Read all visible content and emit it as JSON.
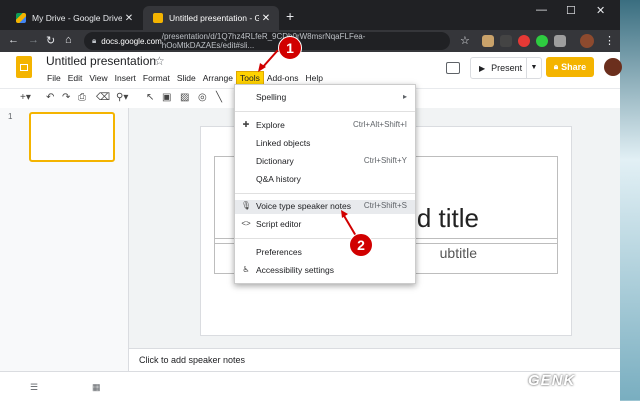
{
  "browser": {
    "tabs": [
      {
        "title": "My Drive - Google Drive",
        "active": false,
        "icon": "drive-icon"
      },
      {
        "title": "Untitled presentation - Google Slides",
        "active": true,
        "icon": "slides-icon"
      }
    ],
    "url_host": "docs.google.com",
    "url_path": "/presentation/d/1Q7hz4RLfeR_9CDh0rW8msrNqaFLFea-hOoMtkDAZAEs/edit#sli..."
  },
  "app": {
    "title": "Untitled presentation",
    "menus": [
      "File",
      "Edit",
      "View",
      "Insert",
      "Format",
      "Slide",
      "Arrange",
      "Tools",
      "Add-ons",
      "Help"
    ],
    "present_label": "Present",
    "share_label": "Share",
    "share_icon": "lock-icon"
  },
  "colors": {
    "accent": "#f4b400",
    "highlight": "#ffd200",
    "annotation": "#d10000"
  },
  "filmstrip": {
    "slide_number": "1"
  },
  "slide": {
    "title_text": "d title",
    "subtitle_text": "ubtitle"
  },
  "notes": {
    "placeholder": "Click to add speaker notes"
  },
  "tools_menu": [
    {
      "label": "Spelling",
      "shortcut": "",
      "icon": "",
      "submenu": true
    },
    {
      "label": "Explore",
      "shortcut": "Ctrl+Alt+Shift+I",
      "icon": "explore-icon"
    },
    {
      "label": "Linked objects",
      "shortcut": "",
      "icon": ""
    },
    {
      "label": "Dictionary",
      "shortcut": "Ctrl+Shift+Y",
      "icon": ""
    },
    {
      "label": "Q&A history",
      "shortcut": "",
      "icon": ""
    },
    {
      "label": "Voice type speaker notes",
      "shortcut": "Ctrl+Shift+S",
      "icon": "microphone-icon"
    },
    {
      "label": "Script editor",
      "shortcut": "",
      "icon": "code-icon"
    },
    {
      "label": "Preferences",
      "shortcut": "",
      "icon": ""
    },
    {
      "label": "Accessibility settings",
      "shortcut": "",
      "icon": "accessibility-icon"
    }
  ],
  "annotations": {
    "step1": "1",
    "step2": "2"
  },
  "watermark": "GENK"
}
